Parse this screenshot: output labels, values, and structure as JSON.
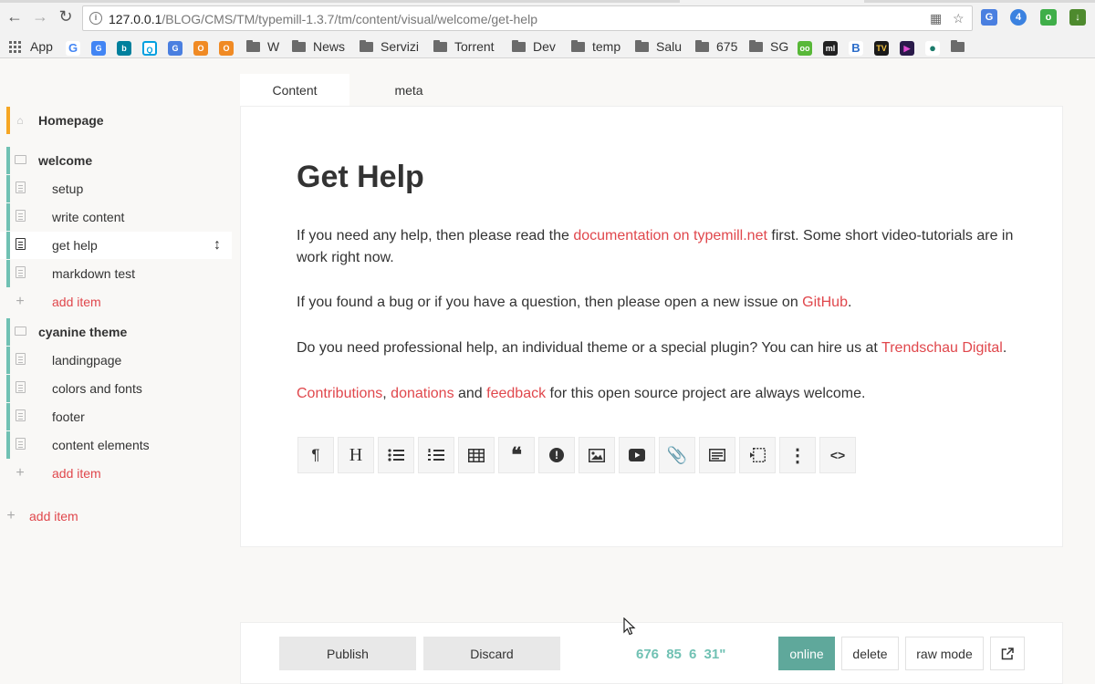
{
  "browser": {
    "url_host": "127.0.0.1",
    "url_path": "/BLOG/CMS/TM/typemill-1.3.7/tm/content/visual/welcome/get-help",
    "badge_count": "4"
  },
  "bookmarks": {
    "app_label": "App",
    "items": [
      "W",
      "News",
      "Servizi",
      "Torrent",
      "Dev",
      "temp",
      "Salu",
      "675",
      "SG"
    ]
  },
  "sidebar": {
    "homepage": "Homepage",
    "folder1": {
      "label": "welcome",
      "pages": [
        "setup",
        "write content",
        "get help",
        "markdown test"
      ],
      "add_label": "add item"
    },
    "folder2": {
      "label": "cyanine theme",
      "pages": [
        "landingpage",
        "colors and fonts",
        "footer",
        "content elements"
      ],
      "add_label": "add item"
    },
    "add_label": "add item"
  },
  "tabs": [
    "Content",
    "meta"
  ],
  "content": {
    "title": "Get Help",
    "p1_before": "If you need any help, then please read the ",
    "p1_link": "documentation on typemill.net",
    "p1_after": " first. Some short video-tutorials are in work right now.",
    "p2_before": "If you found a bug or if you have a question, then please open a new issue on ",
    "p2_link": "GitHub",
    "p2_after": ".",
    "p3_before": "Do you need professional help, an individual theme or a special plugin? You can hire us at ",
    "p3_link": "Trendschau Digital",
    "p3_after": ".",
    "p4_link1": "Contributions",
    "p4_sep1": ", ",
    "p4_link2": "donations",
    "p4_sep2": " and ",
    "p4_link3": "feedback",
    "p4_after": " for this open source project are always welcome."
  },
  "toolbar": {
    "paragraph": "¶",
    "headline": "H",
    "quote": "❝",
    "notice": "!",
    "more": "⋮",
    "code": "<>"
  },
  "actions": {
    "publish": "Publish",
    "discard": "Discard",
    "stats": "676  85  6  31\"",
    "online": "online",
    "delete": "delete",
    "raw_mode": "raw mode"
  }
}
